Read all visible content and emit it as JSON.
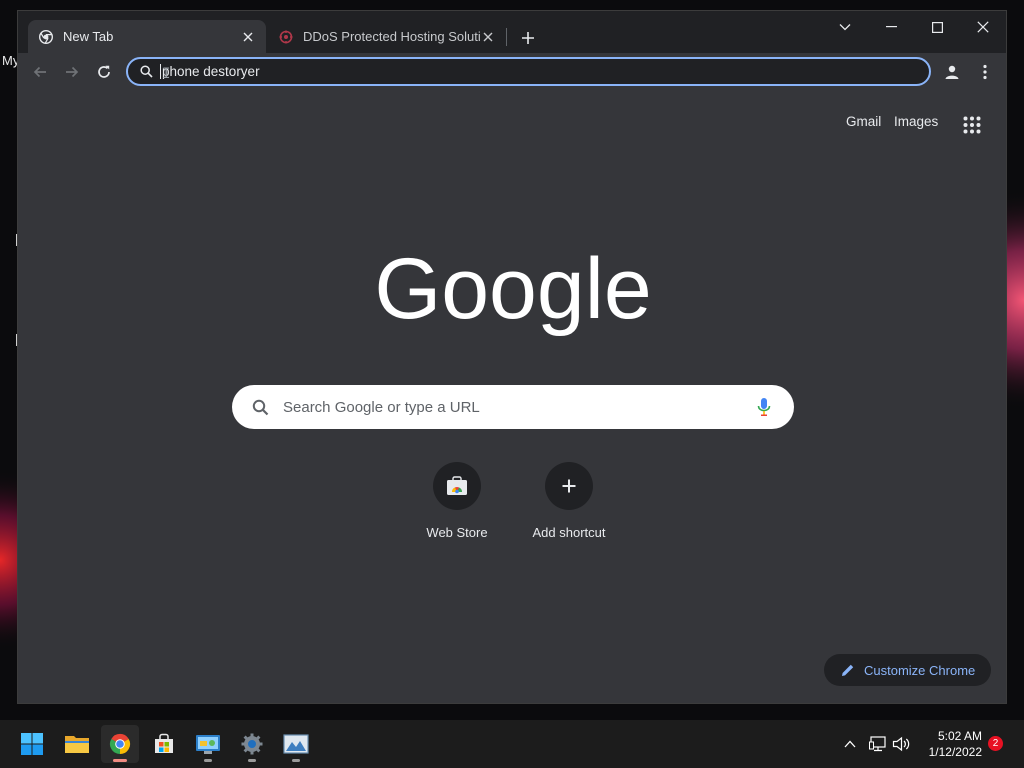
{
  "desktop": {
    "partial_label": "My"
  },
  "browser": {
    "tabs": [
      {
        "title": "New Tab",
        "active": true
      },
      {
        "title": "DDoS Protected Hosting Solutions",
        "active": false
      }
    ],
    "omnibox": {
      "value": "phone destoryer"
    }
  },
  "ntp": {
    "top_links": {
      "gmail": "Gmail",
      "images": "Images"
    },
    "logo_text": "Google",
    "search_placeholder": "Search Google or type a URL",
    "shortcuts": [
      {
        "label": "Web Store"
      },
      {
        "label": "Add shortcut"
      }
    ],
    "customize_label": "Customize Chrome"
  },
  "taskbar": {
    "apps": [
      "start-icon",
      "file-explorer-icon",
      "chrome-icon",
      "store-icon",
      "control-panel-icon",
      "settings-icon",
      "photos-icon"
    ],
    "clock": {
      "time": "5:02 AM",
      "date": "1/12/2022"
    },
    "notification_count": "2"
  },
  "colors": {
    "accent": "#8ab4f8",
    "tab_bg": "#202124",
    "toolbar_bg": "#35363a",
    "page_bg": "#35363a",
    "badge": "#e81123"
  }
}
